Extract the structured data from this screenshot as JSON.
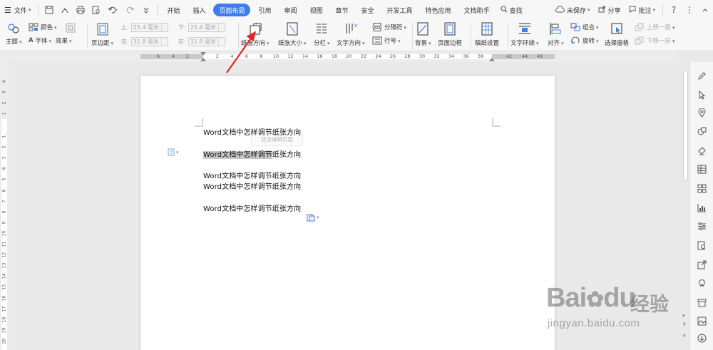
{
  "menubar": {
    "file_label": "文件",
    "tabs": [
      "开始",
      "插入",
      "页面布局",
      "引用",
      "审阅",
      "视图",
      "章节",
      "安全",
      "开发工具",
      "特色应用",
      "文档助手"
    ],
    "active_tab": "页面布局",
    "search_label": "查找",
    "unsaved_label": "未保存",
    "share_label": "分享",
    "comment_label": "批注",
    "help_label": "?",
    "more_label": "⋮",
    "collapse_label": "^"
  },
  "ribbon": {
    "theme_label": "主题",
    "color_label": "颜色",
    "font_label": "字体",
    "effect_label": "效果",
    "margin_label": "页边距",
    "top_label": "上:",
    "top_value": "25.4 毫米",
    "bottom_label": "下:",
    "bottom_value": "25.4 毫米",
    "left_label": "左:",
    "left_value": "31.8 毫米",
    "right_label": "右:",
    "right_value": "31.8 毫米",
    "orientation_label": "纸张方向",
    "size_label": "纸张大小",
    "columns_label": "分栏",
    "text_direction_label": "文字方向",
    "separator_label": "分隔符",
    "line_number_label": "行号",
    "background_label": "背景",
    "page_border_label": "页面边框",
    "manuscript_label": "稿纸设置",
    "wrap_label": "文字环绕",
    "align_label": "对齐",
    "group_label": "组合",
    "rotate_label": "旋转",
    "selection_pane_label": "选择窗格",
    "bring_forward_label": "上移一层",
    "send_backward_label": "下移一层"
  },
  "ruler": {
    "h_left_ticks": [
      "6",
      "4",
      "2"
    ],
    "h_ticks": [
      "2",
      "4",
      "6",
      "8",
      "10",
      "12",
      "14",
      "16",
      "18",
      "20",
      "22",
      "24",
      "26",
      "28",
      "30",
      "32",
      "34",
      "36",
      "38"
    ],
    "h_right_ticks": [
      "42",
      "44",
      "46"
    ],
    "v_top_ticks": [
      "4",
      "3",
      "2",
      "1"
    ],
    "v_ticks": [
      "1",
      "2",
      "3",
      "4",
      "5",
      "6",
      "7",
      "8",
      "9",
      "10",
      "11",
      "12",
      "13",
      "14",
      "15",
      "16",
      "17",
      "18",
      "19",
      "20"
    ]
  },
  "document": {
    "hint": "双击编辑页眉",
    "lines": [
      "Word文档中怎样调节纸张方向",
      "Word文档中怎样调节",
      "纸张方向",
      "Word文档中怎样调节纸张方向",
      "Word文档中怎样调节纸张方向",
      "Word文档中怎样调节纸张方向"
    ]
  },
  "watermark": {
    "brand": "Bai",
    "brand2": "du",
    "cn": "经验",
    "url": "jingyan.baidu.com"
  },
  "colors": {
    "accent": "#3f7ded",
    "annotation_arrow": "#e0262a",
    "selection": "#c8c8c8"
  }
}
